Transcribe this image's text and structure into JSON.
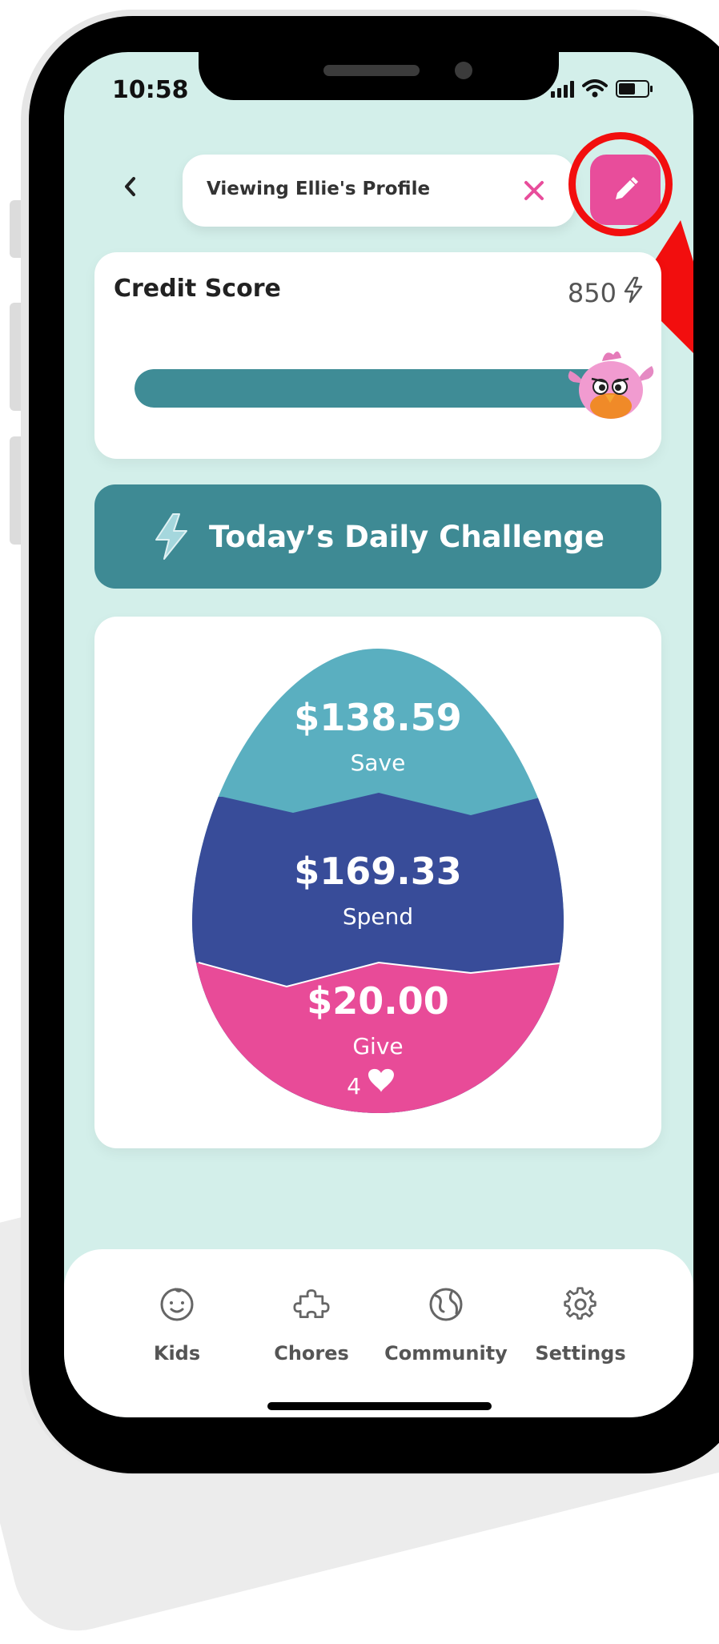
{
  "status_bar": {
    "time": "10:58"
  },
  "header": {
    "profile_label": "Viewing Ellie's Profile"
  },
  "credit_score": {
    "title": "Credit Score",
    "value": "850",
    "fill_fraction": 1.0
  },
  "daily_challenge": {
    "label": "Today’s Daily Challenge"
  },
  "egg": {
    "save": {
      "amount": "$138.59",
      "label": "Save"
    },
    "spend": {
      "amount": "$169.33",
      "label": "Spend"
    },
    "give": {
      "amount": "$20.00",
      "label": "Give",
      "hearts": "4"
    }
  },
  "nav": {
    "items": [
      {
        "label": "Kids",
        "icon": "baby-face-icon"
      },
      {
        "label": "Chores",
        "icon": "puzzle-icon"
      },
      {
        "label": "Community",
        "icon": "globe-icon"
      },
      {
        "label": "Settings",
        "icon": "gear-icon"
      }
    ]
  },
  "colors": {
    "screen_bg": "#d3efea",
    "accent_teal": "#3e8a94",
    "accent_pink": "#e84d9b",
    "save_color": "#5aafc0",
    "spend_color": "#384c99",
    "give_color": "#e84b98",
    "highlight_red": "#f20e0e"
  }
}
